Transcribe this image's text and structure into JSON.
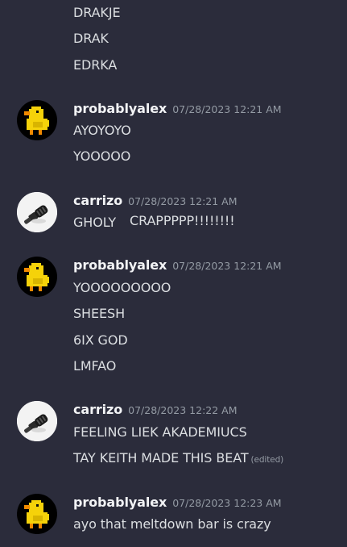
{
  "colors": {
    "background": "#2b2c3b",
    "text": "#dbdee1",
    "author": "#f2f3f5",
    "timestamp": "#949ba4"
  },
  "messages": [
    {
      "lines": [
        "DRAKJE",
        "DRAK",
        "EDRKA"
      ]
    },
    {
      "author": "probablyalex",
      "timestamp": "07/28/2023 12:21 AM",
      "avatar_icon": "duck-avatar-icon",
      "lines": [
        "AYOYOYO",
        "YOOOOO"
      ]
    },
    {
      "author": "carrizo",
      "timestamp": "07/28/2023 12:21 AM",
      "avatar_icon": "microphone-avatar-icon",
      "lines": [
        "GHOLY",
        "CRAPPPPP!!!!!!!!"
      ]
    },
    {
      "author": "probablyalex",
      "timestamp": "07/28/2023 12:21 AM",
      "avatar_icon": "duck-avatar-icon",
      "lines": [
        "YOOOOOOOOO",
        "SHEESH",
        "6IX GOD",
        "LMFAO"
      ]
    },
    {
      "author": "carrizo",
      "timestamp": "07/28/2023 12:22 AM",
      "avatar_icon": "microphone-avatar-icon",
      "lines": [
        "FEELING LIEK AKADEMIUCS",
        "TAY KEITH MADE THIS BEAT"
      ],
      "edited_label": "(edited)"
    },
    {
      "author": "probablyalex",
      "timestamp": "07/28/2023 12:23 AM",
      "avatar_icon": "duck-avatar-icon",
      "lines": [
        "ayo that meltdown bar is crazy"
      ]
    }
  ]
}
